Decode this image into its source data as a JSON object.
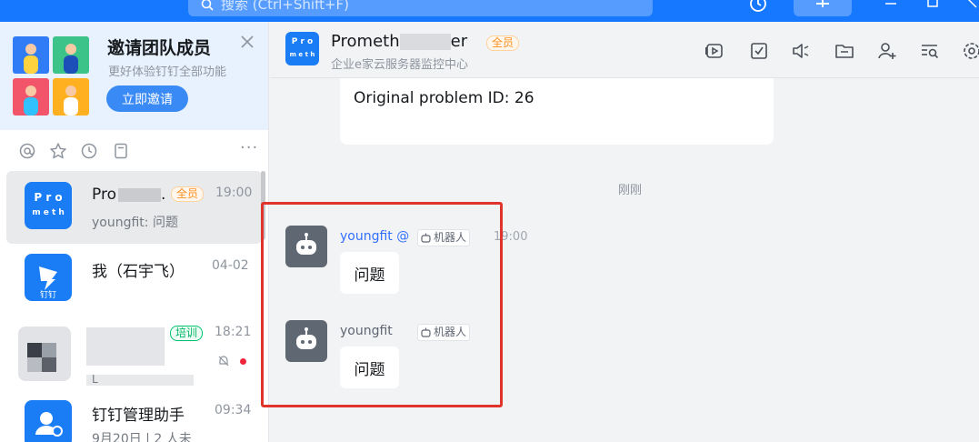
{
  "topbar": {
    "search_placeholder": "搜索 (Ctrl+Shift+F)",
    "icons": [
      "search-icon",
      "history-icon",
      "plus-icon",
      "minimize-icon",
      "maximize-icon",
      "close-icon"
    ]
  },
  "banner": {
    "title": "邀请团队成员",
    "subtitle": "更好体验钉钉全部功能",
    "button": "立即邀请"
  },
  "filters": {
    "icons": [
      "mention-icon",
      "star-icon",
      "clock-icon",
      "doc-icon"
    ],
    "more": "···"
  },
  "conversations": [
    {
      "name": "Pro",
      "name_suffix": ".",
      "tag": "全员",
      "time": "19:00",
      "preview": "youngfit: 问题",
      "avatar_line1": "P r o",
      "avatar_line2": "m e t h"
    },
    {
      "name": "我（石宇飞）",
      "time": "04-02",
      "avatar_label": "钉钉"
    },
    {
      "tag": "培训",
      "time": "18:21",
      "preview": "L"
    },
    {
      "name": "钉钉管理助手",
      "time": "09:34",
      "preview": "9月20日 | 2 人未"
    }
  ],
  "chat": {
    "title_start": "Prometh",
    "title_end": "er",
    "title_tag": "全员",
    "subtitle": "企业e家云服务器监控中心",
    "avatar_line1": "P r o",
    "avatar_line2": "m e t h",
    "tools": [
      "video-icon",
      "task-icon",
      "speaker-icon",
      "folder-icon",
      "add-member-icon",
      "search-list-icon",
      "settings-icon"
    ]
  },
  "messages": {
    "card_text": "Original problem ID: 26",
    "time_separator": "刚刚",
    "items": [
      {
        "sender": "youngfit @",
        "tag": "机器人",
        "time": "19:00",
        "text": "问题"
      },
      {
        "sender": "youngfit",
        "tag": "机器人",
        "text": "问题"
      }
    ]
  },
  "colors": {
    "accent": "#1677ff",
    "highlight_box": "#e0332b",
    "tag_all": "#ff8f1f",
    "tag_train": "#00b365"
  }
}
